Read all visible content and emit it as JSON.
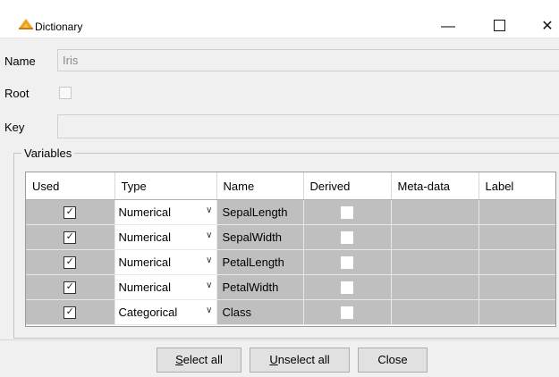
{
  "window": {
    "title": "Dictionary",
    "min_glyph": "—",
    "close_glyph": "✕"
  },
  "form": {
    "name_label": "Name",
    "name_value": "Iris",
    "root_label": "Root",
    "key_label": "Key",
    "key_value": ""
  },
  "variables": {
    "legend": "Variables",
    "columns": [
      "Used",
      "Type",
      "Name",
      "Derived",
      "Meta-data",
      "Label"
    ],
    "rows": [
      {
        "used": true,
        "type": "Numerical",
        "name": "SepalLength",
        "derived": false,
        "metadata": "",
        "label": ""
      },
      {
        "used": true,
        "type": "Numerical",
        "name": "SepalWidth",
        "derived": false,
        "metadata": "",
        "label": ""
      },
      {
        "used": true,
        "type": "Numerical",
        "name": "PetalLength",
        "derived": false,
        "metadata": "",
        "label": ""
      },
      {
        "used": true,
        "type": "Numerical",
        "name": "PetalWidth",
        "derived": false,
        "metadata": "",
        "label": ""
      },
      {
        "used": true,
        "type": "Categorical",
        "name": "Class",
        "derived": false,
        "metadata": "",
        "label": ""
      }
    ]
  },
  "buttons": {
    "select_all_mnemonic": "S",
    "select_all_rest": "elect all",
    "unselect_all_mnemonic": "U",
    "unselect_all_rest": "nselect all",
    "close": "Close"
  },
  "icons": {
    "app": "dictionary-app-icon",
    "checkbox_checked": "check-icon",
    "dropdown": "chevron-down-icon"
  },
  "colors": {
    "disabled_cell": "#bfbfbf",
    "dialog_bg": "#f0f0f0",
    "app_icon_orange": "#f0a020"
  }
}
